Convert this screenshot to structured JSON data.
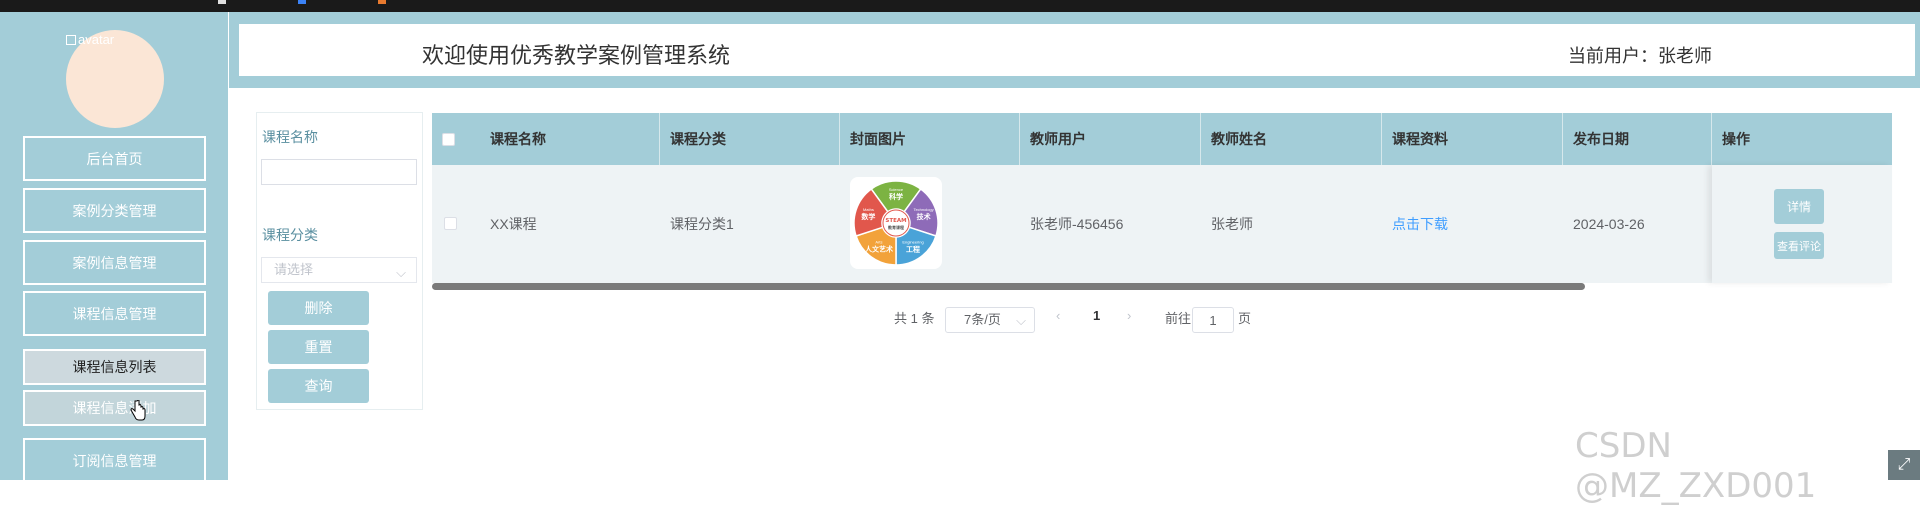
{
  "header": {
    "title": "欢迎使用优秀教学案例管理系统",
    "current_user": "当前用户：张老师"
  },
  "sidebar": {
    "avatar_alt": "avatar",
    "items": [
      {
        "label": "后台首页"
      },
      {
        "label": "案例分类管理"
      },
      {
        "label": "案例信息管理"
      },
      {
        "label": "课程信息管理"
      },
      {
        "label": "课程信息列表"
      },
      {
        "label": "课程信息添加"
      },
      {
        "label": "订阅信息管理"
      }
    ]
  },
  "search": {
    "course_name_label": "课程名称",
    "course_name_value": "",
    "category_label": "课程分类",
    "category_placeholder": "请选择",
    "delete_label": "删除",
    "reset_label": "重置",
    "query_label": "查询"
  },
  "table": {
    "columns": [
      "课程名称",
      "课程分类",
      "封面图片",
      "教师用户",
      "教师姓名",
      "课程资料",
      "发布日期",
      "操作"
    ],
    "rows": [
      {
        "course_name": "XX课程",
        "category": "课程分类1",
        "cover_icon": "steam-wheel-image",
        "teacher_user": "张老师-456456",
        "teacher_name": "张老师",
        "material_link": "点击下载",
        "date": "2024-03-26",
        "detail_label": "详情",
        "comment_label": "查看评论"
      }
    ]
  },
  "cover_image": {
    "center_line1": "STEAM",
    "center_line2": "教育课程",
    "segments": [
      {
        "en": "Science",
        "cn": "科学",
        "color": "#7cb342"
      },
      {
        "en": "Technology",
        "cn": "技术",
        "color": "#8e6bb8"
      },
      {
        "en": "Engineering",
        "cn": "工程",
        "color": "#4aa3d8"
      },
      {
        "en": "Arts",
        "cn": "人文艺术",
        "color": "#f2a23a"
      },
      {
        "en": "Maths",
        "cn": "数学",
        "color": "#e1574c"
      }
    ]
  },
  "pagination": {
    "total": "共 1 条",
    "page_size": "7条/页",
    "prev": "‹",
    "current": "1",
    "next": "›",
    "goto_label": "前往",
    "goto_value": "1",
    "page_suffix": "页"
  },
  "watermark": "CSDN @MZ_ZXD001",
  "colors": {
    "accent": "#a3cdd8",
    "link": "#409eff",
    "row_bg": "#eef3f5",
    "avatar_bg": "#fbe6d6"
  }
}
